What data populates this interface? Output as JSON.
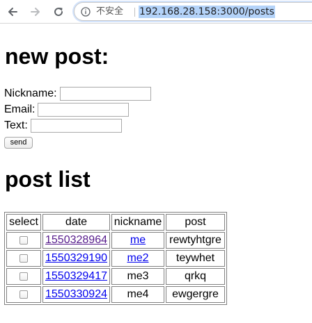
{
  "browser": {
    "security_label": "不安全",
    "url": "192.168.28.158:3000/posts"
  },
  "form": {
    "heading": "new post:",
    "nickname_label": "Nickname:",
    "email_label": "Email:",
    "text_label": "Text:",
    "nickname_value": "",
    "email_value": "",
    "text_value": "",
    "send_label": "send"
  },
  "list": {
    "heading": "post list",
    "headers": {
      "select": "select",
      "date": "date",
      "nickname": "nickname",
      "post": "post"
    },
    "rows": [
      {
        "date": "1550328964",
        "nickname": "me",
        "post": "rewtyhtgre"
      },
      {
        "date": "1550329190",
        "nickname": "me2",
        "post": "teywhet"
      },
      {
        "date": "1550329417",
        "nickname": "me3",
        "post": "qrkq"
      },
      {
        "date": "1550330924",
        "nickname": "me4",
        "post": "ewgergre"
      }
    ]
  },
  "icons": {
    "back": "arrow-left-icon",
    "forward": "arrow-right-icon",
    "reload": "reload-icon",
    "info": "info-icon"
  }
}
